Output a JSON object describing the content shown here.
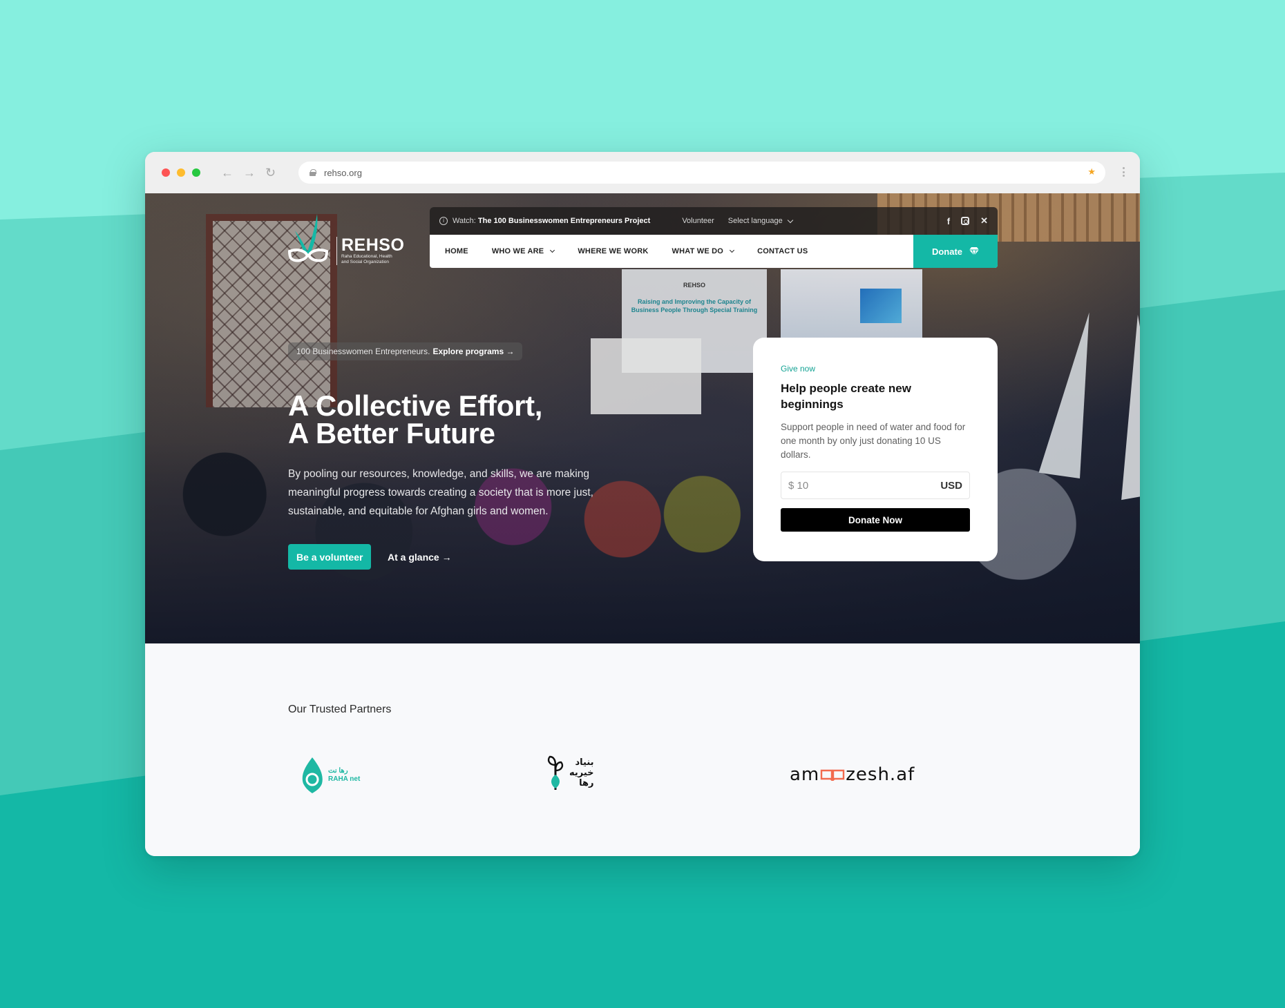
{
  "browser": {
    "url": "rehso.org",
    "nav_icons": [
      "back-arrow-icon",
      "forward-arrow-icon",
      "reload-icon"
    ],
    "bookmark_icon": "star-icon",
    "menu_icon": "kebab-menu-icon"
  },
  "site": {
    "brand": {
      "name": "REHSO",
      "subtitle_line1": "Raha Educational, Health",
      "subtitle_line2": "and Social Organization"
    },
    "topbar": {
      "watch_prefix": "Watch:",
      "watch_title": "The 100 Businesswomen Entrepreneurs Project",
      "volunteer": "Volunteer",
      "language": "Select language",
      "socials": [
        "facebook-icon",
        "instagram-icon",
        "x-icon"
      ],
      "facebook_glyph": "f",
      "x_glyph": "✕"
    },
    "nav": {
      "items": [
        {
          "label": "HOME",
          "dropdown": false
        },
        {
          "label": "WHO WE ARE",
          "dropdown": true
        },
        {
          "label": "WHERE WE WORK",
          "dropdown": false
        },
        {
          "label": "WHAT WE DO",
          "dropdown": true
        },
        {
          "label": "CONTACT US",
          "dropdown": false
        }
      ],
      "donate_label": "Donate"
    },
    "hero": {
      "pill_text": "100 Businesswomen Entrepreneurs.",
      "pill_link": "Explore programs →",
      "title_line1": "A Collective Effort,",
      "title_line2": "A Better Future",
      "description": "By pooling our resources, knowledge, and skills, we are making meaningful progress towards creating a society that is more just, sustainable, and equitable for Afghan girls and women.",
      "primary_button": "Be a volunteer",
      "secondary_button": "At a glance →",
      "background_banner_title": "Raising and Improving the Capacity of Business People Through Special Training",
      "background_banner_logo": "REHSO"
    },
    "donation_card": {
      "eyebrow": "Give now",
      "title": "Help people create new beginnings",
      "description": "Support people in need of water and food for one month by only just donating 10 US dollars.",
      "amount_prefix": "$",
      "amount_value": "10",
      "currency": "USD",
      "button": "Donate Now"
    },
    "partners": {
      "heading": "Our Trusted Partners",
      "items": [
        {
          "name": "Raha net",
          "arabic": "رها نت",
          "latin": "RAHA net"
        },
        {
          "name": "Bonyad Khairia Raha",
          "arabic_line1": "بنیاد",
          "arabic_line2": "خیریه",
          "arabic_line3": "رها"
        },
        {
          "name": "amoozesh.af",
          "before": "am",
          "after": "zesh.af"
        }
      ]
    }
  },
  "colors": {
    "brand_teal": "#14b8a6",
    "bg_light_teal": "#86efdf",
    "bg_mid_teal": "#44c9b7",
    "bg_dark_teal": "#14b8a6",
    "book_orange": "#f26b4f"
  }
}
